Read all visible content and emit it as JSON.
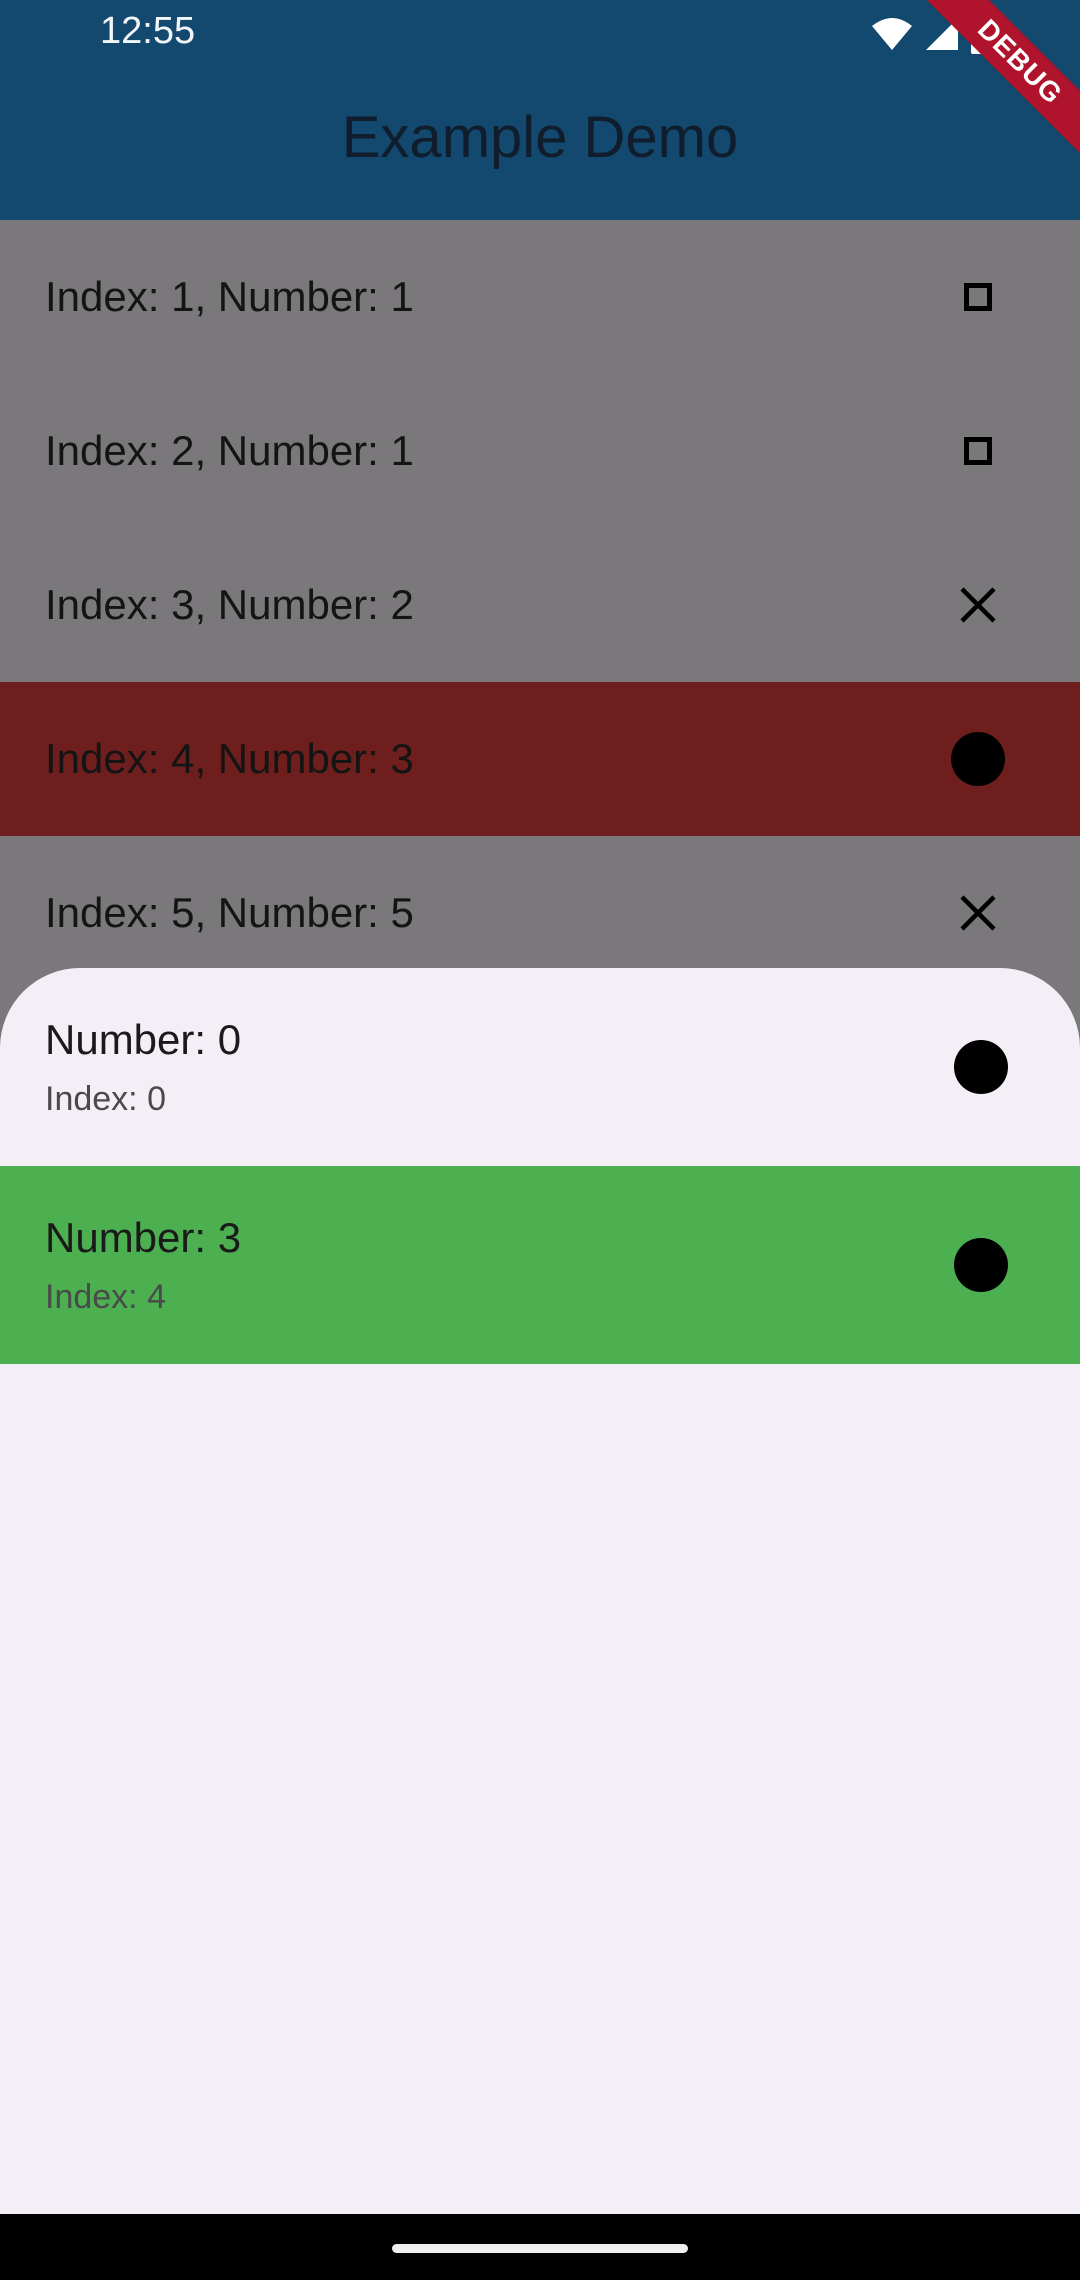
{
  "status_bar": {
    "time": "12:55",
    "icons": [
      "wifi-icon",
      "signal-icon",
      "battery-icon"
    ]
  },
  "app_bar": {
    "title": "Example Demo",
    "background": "#13486f"
  },
  "debug_banner": {
    "text": "DEBUG",
    "color": "#b0132c"
  },
  "background_list": {
    "items": [
      {
        "label": "Index: 1, Number: 1",
        "icon": "square-outline-icon"
      },
      {
        "label": "Index: 2, Number: 1",
        "icon": "square-outline-icon"
      },
      {
        "label": "Index: 3, Number: 2",
        "icon": "close-icon"
      },
      {
        "label": "Index: 4, Number: 3",
        "icon": "filled-circle-icon",
        "highlighted": true,
        "highlight_color": "#6e1f1d"
      },
      {
        "label": "Index: 5, Number: 5",
        "icon": "close-icon"
      }
    ]
  },
  "bottom_sheet": {
    "items": [
      {
        "title": "Number: 0",
        "subtitle": "Index: 0",
        "icon": "filled-circle-icon",
        "selected": false
      },
      {
        "title": "Number: 3",
        "subtitle": "Index: 4",
        "icon": "filled-circle-icon",
        "selected": true,
        "selected_color": "#4caf50"
      }
    ]
  }
}
